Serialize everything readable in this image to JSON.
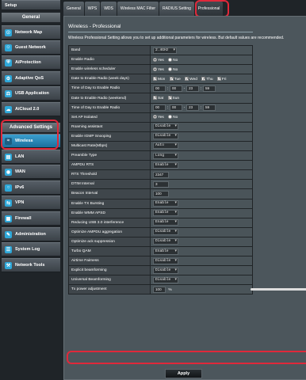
{
  "sidebar": {
    "top_item": "Setup",
    "general_header": "General",
    "general_items": [
      {
        "label": "Network Map",
        "icon": "network-map-icon"
      },
      {
        "label": "Guest Network",
        "icon": "guest-network-icon"
      },
      {
        "label": "AiProtection",
        "icon": "shield-icon"
      },
      {
        "label": "Adaptive QoS",
        "icon": "qos-icon"
      },
      {
        "label": "USB Application",
        "icon": "usb-icon"
      },
      {
        "label": "AiCloud 2.0",
        "icon": "cloud-icon"
      }
    ],
    "advanced_header": "Advanced Settings",
    "advanced_items": [
      {
        "label": "Wireless",
        "icon": "wireless-icon",
        "active": true
      },
      {
        "label": "LAN",
        "icon": "lan-icon"
      },
      {
        "label": "WAN",
        "icon": "wan-icon"
      },
      {
        "label": "IPv6",
        "icon": "ipv6-icon"
      },
      {
        "label": "VPN",
        "icon": "vpn-icon"
      },
      {
        "label": "Firewall",
        "icon": "firewall-icon"
      },
      {
        "label": "Administration",
        "icon": "administration-icon"
      },
      {
        "label": "System Log",
        "icon": "system-log-icon"
      },
      {
        "label": "Network Tools",
        "icon": "network-tools-icon"
      }
    ]
  },
  "tabs": [
    "General",
    "WPS",
    "WDS",
    "Wireless MAC Filter",
    "RADIUS Setting",
    "Professional"
  ],
  "active_tab": "Professional",
  "panel": {
    "title": "Wireless - Professional",
    "description": "Wireless Professional Setting allows you to set up additional parameters for wireless. But default values are recommended."
  },
  "settings": {
    "band": {
      "label": "Band",
      "value": "2.4GHz"
    },
    "enable_radio": {
      "label": "Enable Radio",
      "yes": "Yes",
      "no": "No",
      "selected": "Yes"
    },
    "enable_scheduler": {
      "label": "Enable wireless scheduler",
      "yes": "Yes",
      "no": "No",
      "selected": "Yes"
    },
    "date_week": {
      "label": "Date to Enable Radio (week days)",
      "days": [
        "Mon",
        "Tue",
        "Wed",
        "Thu",
        "Fri"
      ]
    },
    "time_week": {
      "label": "Time of Day to Enable Radio",
      "h1": "00",
      "m1": "00",
      "h2": "23",
      "m2": "59"
    },
    "date_weekend": {
      "label": "Date to Enable Radio (weekend)",
      "days": [
        "Sat",
        "Sun"
      ]
    },
    "time_weekend": {
      "label": "Time of Day to Enable Radio",
      "h1": "00",
      "m1": "00",
      "h2": "23",
      "m2": "59"
    },
    "ap_isolated": {
      "label": "Set AP Isolated",
      "yes": "Yes",
      "no": "No",
      "selected": "Yes"
    },
    "roaming": {
      "label": "Roaming assistant",
      "value": "Disable"
    },
    "igmp": {
      "label": "Enable IGMP Snooping",
      "value": "Disable"
    },
    "multicast": {
      "label": "Multicast Rate(Mbps)",
      "value": "Auto"
    },
    "preamble": {
      "label": "Preamble Type",
      "value": "Long"
    },
    "ampdu_rts": {
      "label": "AMPDU RTS",
      "value": "Enable"
    },
    "rts": {
      "label": "RTS Threshold",
      "value": "2347"
    },
    "dtim": {
      "label": "DTIM Interval",
      "value": "3"
    },
    "beacon": {
      "label": "Beacon Interval",
      "value": "100"
    },
    "tx_bursting": {
      "label": "Enable TX Bursting",
      "value": "Enable"
    },
    "wmm_apsd": {
      "label": "Enable WMM APSD",
      "value": "Enable"
    },
    "usb3": {
      "label": "Reducing USB 3.0 interference",
      "value": "Enable"
    },
    "ampdu_agg": {
      "label": "Optimize AMPDU aggregation",
      "value": "Disable"
    },
    "ack": {
      "label": "Optimize ack suppression",
      "value": "Disable"
    },
    "turbo": {
      "label": "Turbo QAM",
      "value": "Enable"
    },
    "airtime": {
      "label": "Airtime Fairness",
      "value": "Disable"
    },
    "explicit_bf": {
      "label": "Explicit beamforming",
      "value": "Disable"
    },
    "universal_bf": {
      "label": "Universal Beamforming",
      "value": "Disable"
    },
    "tx_power": {
      "label": "Tx power adjustment",
      "value": "100",
      "unit": "%",
      "level_percent": 100
    }
  },
  "apply_label": "Apply",
  "highlight_color": "#e0283a"
}
